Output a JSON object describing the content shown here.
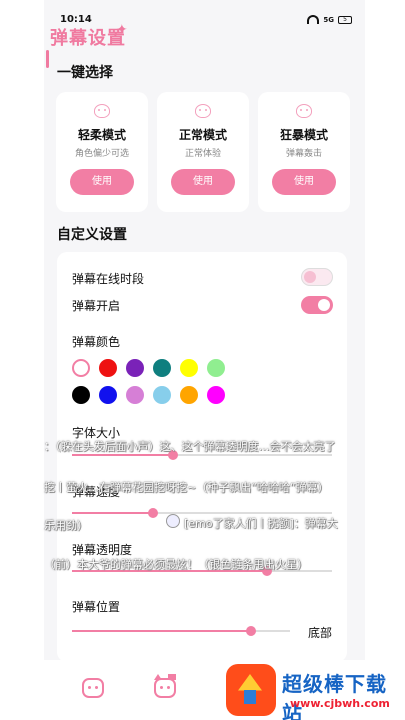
{
  "status_bar": {
    "time": "10:14",
    "signal": "5G",
    "battery": "5"
  },
  "header": {
    "app_title": "弹幕设置"
  },
  "presets": {
    "section_title": "一键选择",
    "cards": [
      {
        "name": "轻柔模式",
        "desc": "角色偏少可选",
        "button": "使用"
      },
      {
        "name": "正常模式",
        "desc": "正常体验",
        "button": "使用"
      },
      {
        "name": "狂暴模式",
        "desc": "弹幕轰击",
        "button": "使用"
      }
    ]
  },
  "custom": {
    "section_title": "自定义设置",
    "online_label": "弹幕在线时段",
    "online_enabled": false,
    "danmaku_on_label": "弹幕开启",
    "danmaku_on_enabled": true,
    "color_label": "弹幕颜色",
    "colors": [
      "#ffffff",
      "#ee1111",
      "#7a22b8",
      "#0f7f7f",
      "#ffff00",
      "#90ee90",
      "#000000",
      "#1111ee",
      "#d67fd6",
      "#87ceeb",
      "#ffa500",
      "#ff00ff"
    ],
    "selected_color": "#ffffff",
    "font_size_label": "字体大小",
    "font_size_value": 0.39,
    "speed_label": "弹幕速度",
    "speed_value": 0.31,
    "opacity_label": "弹幕透明度",
    "opacity_value": 0.75,
    "position_label": "弹幕位置",
    "position_value": 0.82,
    "position_text": "底部"
  },
  "danmaku_overlay": [
    "：（躲在头发后面小声）这、这个弹幕透明度…会不会太亮了",
    "挖丨萤火…在弹幕花园挖呀挖~（种子飘出“哈哈哈”弹幕）",
    "乐用劲）",
    "[emo了家人们丨抚额]：弹幕大",
    "（前）本大爷的弹幕必须最炫！（银色链条甩出火星）"
  ],
  "watermark": {
    "title": "超级棒下载站",
    "url": "www.cjbwh.com"
  }
}
